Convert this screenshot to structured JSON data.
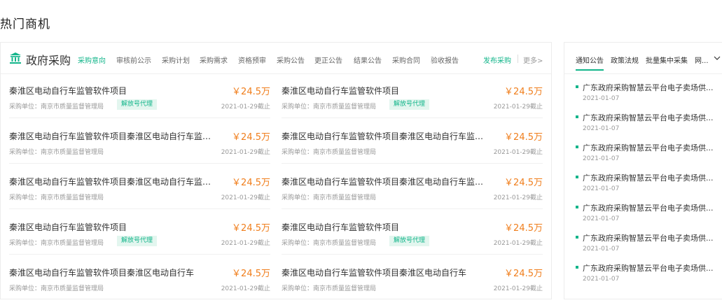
{
  "page_title": "热门商机",
  "panel": {
    "title": "政府采购",
    "icon": "government-building-icon",
    "tabs": [
      "采购意向",
      "审核前公示",
      "采购计划",
      "采购需求",
      "资格预审",
      "采购公告",
      "更正公告",
      "结果公告",
      "采购合同",
      "验收报告"
    ],
    "active_tab": "采购意向",
    "publish": "发布采购",
    "more": "更多>"
  },
  "items": [
    {
      "title": "秦淮区电动自行车监管软件项目",
      "price": "￥24.5万",
      "unit": "采购单位：南京市质量监督管理局",
      "badge": "解放号代理",
      "date": "2021-01-29截止"
    },
    {
      "title": "秦淮区电动自行车监管软件项目",
      "price": "￥24.5万",
      "unit": "采购单位：南京市质量监督管理局",
      "badge": "解放号代理",
      "date": "2021-01-29截止"
    },
    {
      "title": "秦淮区电动自行车监管软件项目秦淮区电动自行车监管软...",
      "price": "￥24.5万",
      "unit": "采购单位：南京市质量监督管理局",
      "badge": "",
      "date": "2021-01-29截止"
    },
    {
      "title": "秦淮区电动自行车监管软件项目秦淮区电动自行车监管软...",
      "price": "￥24.5万",
      "unit": "采购单位：南京市质量监督管理局",
      "badge": "",
      "date": "2021-01-29截止"
    },
    {
      "title": "秦淮区电动自行车监管软件项目秦淮区电动自行车监管软...",
      "price": "￥24.5万",
      "unit": "采购单位：南京市质量监督管理局",
      "badge": "",
      "date": "2021-01-29截止"
    },
    {
      "title": "秦淮区电动自行车监管软件项目秦淮区电动自行车监管软...",
      "price": "￥24.5万",
      "unit": "采购单位：南京市质量监督管理局",
      "badge": "",
      "date": "2021-01-29截止"
    },
    {
      "title": "秦淮区电动自行车监管软件项目",
      "price": "￥24.5万",
      "unit": "采购单位：南京市质量监督管理局",
      "badge": "解放号代理",
      "date": "2021-01-29截止"
    },
    {
      "title": "秦淮区电动自行车监管软件项目",
      "price": "￥24.5万",
      "unit": "采购单位：南京市质量监督管理局",
      "badge": "解放号代理",
      "date": "2021-01-29截止"
    },
    {
      "title": "秦淮区电动自行车监管软件项目秦淮区电动自行车",
      "price": "￥24.5万",
      "unit": "采购单位：南京市质量监督管理局",
      "badge": "",
      "date": "2021-01-29截止"
    },
    {
      "title": "秦淮区电动自行车监管软件项目秦淮区电动自行车",
      "price": "￥24.5万",
      "unit": "采购单位：南京市质量监督管理局",
      "badge": "",
      "date": "2021-01-29截止"
    }
  ],
  "side": {
    "tabs": [
      "通知公告",
      "政策法规",
      "批量集中采集",
      "网..."
    ],
    "active_tab": "通知公告",
    "chevron": "chevron-down-icon",
    "notices": [
      {
        "title": "广东政府采购智慧云平台电子卖场供...",
        "date": "2021-01-07"
      },
      {
        "title": "广东政府采购智慧云平台电子卖场供...",
        "date": "2021-01-07"
      },
      {
        "title": "广东政府采购智慧云平台电子卖场供...",
        "date": "2021-01-07"
      },
      {
        "title": "广东政府采购智慧云平台电子卖场供...",
        "date": "2021-01-07"
      },
      {
        "title": "广东政府采购智慧云平台电子卖场供...",
        "date": "2021-01-07"
      },
      {
        "title": "广东政府采购智慧云平台电子卖场供...",
        "date": "2021-01-07"
      },
      {
        "title": "广东政府采购智慧云平台电子卖场供...",
        "date": "2021-01-07"
      }
    ]
  },
  "colors": {
    "accent": "#12b58a",
    "price": "#f07e1c",
    "muted": "#999999"
  }
}
